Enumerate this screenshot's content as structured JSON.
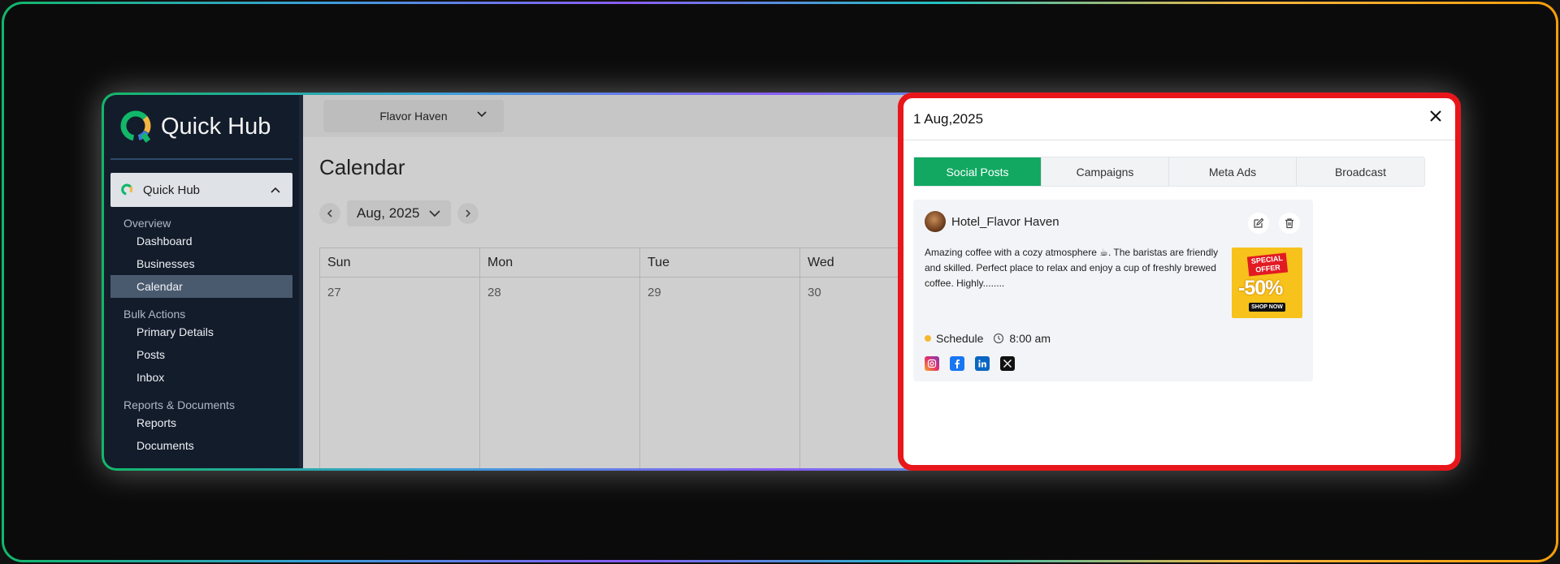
{
  "sidebar": {
    "brand": "Quick Hub",
    "workspace": "Quick Hub",
    "sections": [
      {
        "title": "Overview",
        "items": [
          "Dashboard",
          "Businesses",
          "Calendar"
        ]
      },
      {
        "title": "Bulk Actions",
        "items": [
          "Primary Details",
          "Posts",
          "Inbox"
        ]
      },
      {
        "title": "Reports & Documents",
        "items": [
          "Reports",
          "Documents"
        ]
      }
    ],
    "active_item": "Calendar"
  },
  "header": {
    "business_select": "Flavor Haven"
  },
  "calendar": {
    "title": "Calendar",
    "month_label": "Aug, 2025",
    "weekdays": [
      "Sun",
      "Mon",
      "Tue",
      "Wed"
    ],
    "dates": [
      "27",
      "28",
      "29",
      "30"
    ]
  },
  "panel": {
    "date": "1 Aug,2025",
    "tabs": [
      "Social Posts",
      "Campaigns",
      "Meta Ads",
      "Broadcast"
    ],
    "active_tab": "Social Posts",
    "post": {
      "author": "Hotel_Flavor Haven",
      "text": "Amazing coffee with a cozy atmosphere ☕. The baristas are friendly and skilled. Perfect place to relax and enjoy a cup of freshly brewed coffee. Highly........",
      "status": "Schedule",
      "time": "8:00 am",
      "promo": {
        "line1": "SPECIAL",
        "line2": "OFFER",
        "discount": "-50%",
        "cta": "SHOP NOW"
      },
      "platforms": [
        "instagram-icon",
        "facebook-icon",
        "linkedin-icon",
        "x-icon"
      ]
    }
  },
  "colors": {
    "accent": "#12a862",
    "highlight_border": "#e8161b",
    "sidebar_bg": "#131c2b",
    "status_dot": "#f5b82e"
  }
}
